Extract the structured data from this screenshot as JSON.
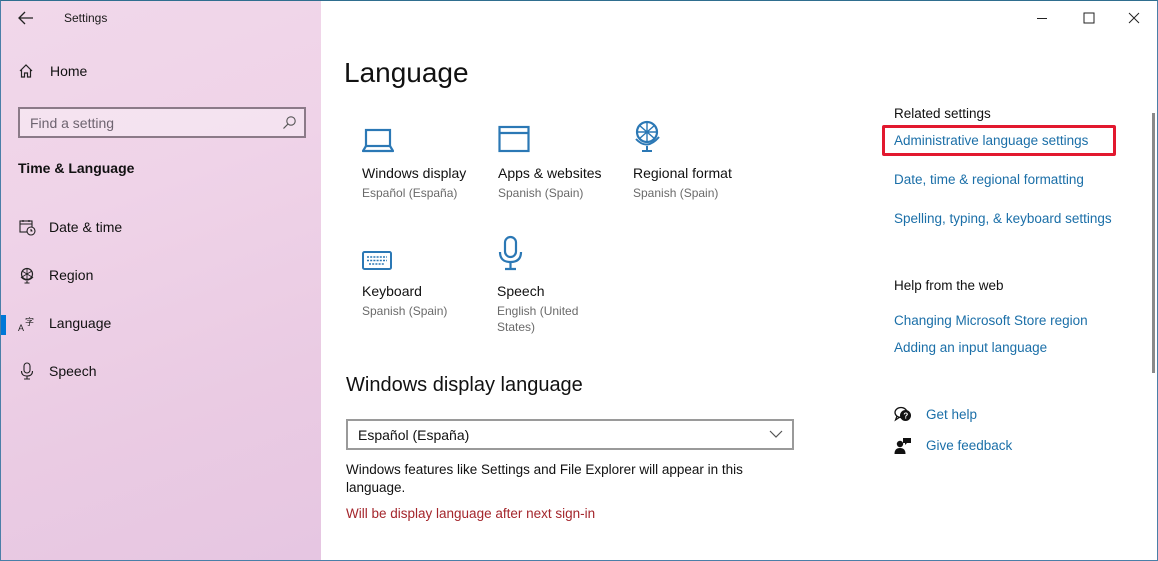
{
  "window": {
    "title": "Settings",
    "controls": {
      "minimize": "minimize",
      "maximize": "maximize",
      "close": "close"
    }
  },
  "sidebar": {
    "home_label": "Home",
    "search_placeholder": "Find a setting",
    "section_title": "Time & Language",
    "items": [
      {
        "label": "Date & time",
        "icon": "calendar-clock-icon",
        "active": false
      },
      {
        "label": "Region",
        "icon": "globe-icon",
        "active": false
      },
      {
        "label": "Language",
        "icon": "language-icon",
        "active": true
      },
      {
        "label": "Speech",
        "icon": "microphone-icon",
        "active": false
      }
    ]
  },
  "main": {
    "title": "Language",
    "tiles": [
      {
        "name": "Windows display",
        "value": "Español (España)",
        "icon": "laptop-icon"
      },
      {
        "name": "Apps & websites",
        "value": "Spanish (Spain)",
        "icon": "browser-window-icon"
      },
      {
        "name": "Regional format",
        "value": "Spanish (Spain)",
        "icon": "globe-icon"
      },
      {
        "name": "Keyboard",
        "value": "Spanish (Spain)",
        "icon": "keyboard-icon"
      },
      {
        "name": "Speech",
        "value": "English (United States)",
        "icon": "microphone-icon"
      }
    ],
    "display_language": {
      "heading": "Windows display language",
      "selected": "Español (España)",
      "description": "Windows features like Settings and File Explorer will appear in this language.",
      "warning": "Will be display language after next sign-in"
    }
  },
  "related": {
    "heading": "Related settings",
    "links": [
      "Administrative language settings",
      "Date, time & regional formatting",
      "Spelling, typing, & keyboard settings"
    ]
  },
  "help": {
    "heading": "Help from the web",
    "links": [
      "Changing Microsoft Store region",
      "Adding an input language"
    ],
    "get_help": "Get help",
    "give_feedback": "Give feedback"
  },
  "colors": {
    "accent": "#0078d7",
    "link": "#1b6fa8",
    "warning": "#a4262c",
    "highlight_box": "#e2182f"
  }
}
